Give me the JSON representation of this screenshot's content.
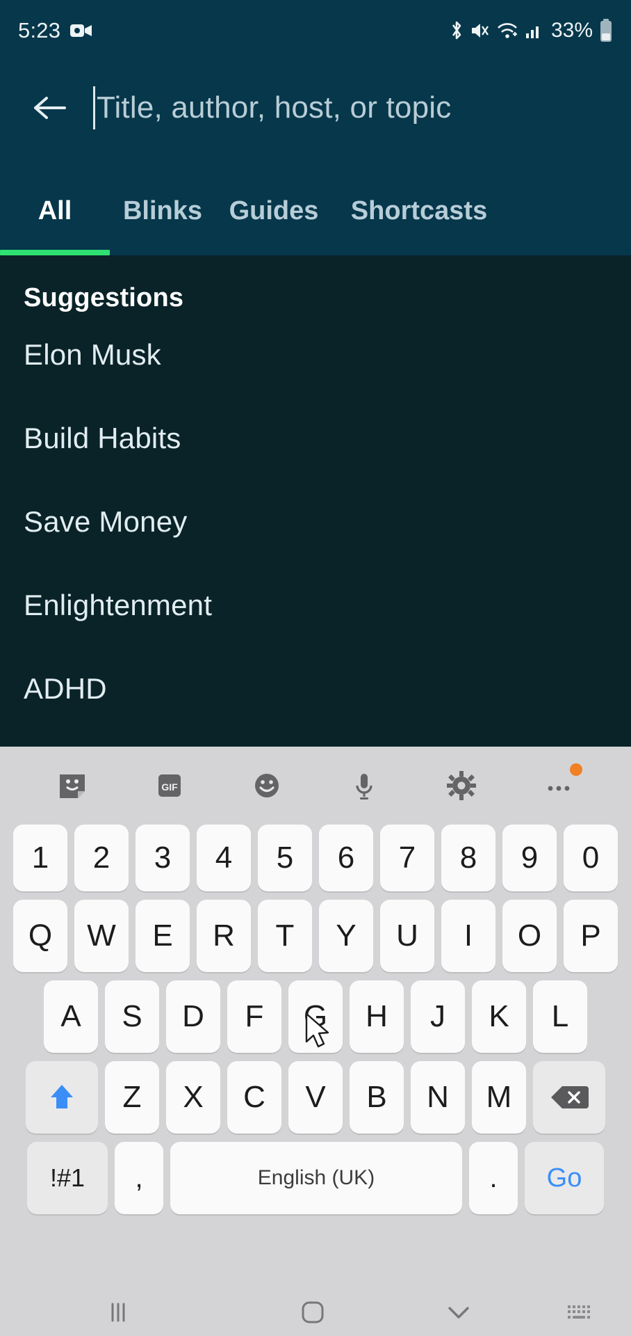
{
  "status_bar": {
    "time": "5:23",
    "battery_percent": "33%",
    "icons": [
      "video-record-icon",
      "bluetooth-icon",
      "mute-vibrate-icon",
      "wifi-icon",
      "cellular-signal-icon",
      "battery-icon"
    ]
  },
  "search": {
    "placeholder": "Title, author, host, or topic",
    "value": "",
    "back_icon": "back-arrow-icon"
  },
  "tabs": {
    "items": [
      {
        "label": "All",
        "active": true
      },
      {
        "label": "Blinks",
        "active": false
      },
      {
        "label": "Guides",
        "active": false
      },
      {
        "label": "Shortcasts",
        "active": false
      }
    ],
    "indicator_color": "#2fe172"
  },
  "suggestions": {
    "header": "Suggestions",
    "items": [
      "Elon Musk",
      "Build Habits",
      "Save Money",
      "Enlightenment",
      "ADHD"
    ]
  },
  "keyboard": {
    "toolbar": [
      "sticker-icon",
      "gif-icon",
      "emoji-icon",
      "microphone-icon",
      "settings-gear-icon",
      "more-options-icon"
    ],
    "row_numbers": [
      "1",
      "2",
      "3",
      "4",
      "5",
      "6",
      "7",
      "8",
      "9",
      "0"
    ],
    "row_top": [
      "Q",
      "W",
      "E",
      "R",
      "T",
      "Y",
      "U",
      "I",
      "O",
      "P"
    ],
    "row_home": [
      "A",
      "S",
      "D",
      "F",
      "G",
      "H",
      "J",
      "K",
      "L"
    ],
    "row_bottom": [
      "Z",
      "X",
      "C",
      "V",
      "B",
      "N",
      "M"
    ],
    "shift_icon": "shift-arrow-icon",
    "backspace_icon": "backspace-icon",
    "symbols_key": "!#1",
    "comma_key": ",",
    "space_key": "English (UK)",
    "period_key": ".",
    "action_key": "Go",
    "action_key_color": "#3a8ef6"
  },
  "nav_bar": {
    "items": [
      "recents-icon",
      "home-icon",
      "hide-keyboard-icon",
      "keyboard-switcher-icon"
    ]
  },
  "theme": {
    "header_bg": "#06374b",
    "content_bg": "#0a2329",
    "keyboard_bg": "#d4d4d6",
    "key_bg": "#fafafa",
    "accent_green": "#2fe172"
  }
}
